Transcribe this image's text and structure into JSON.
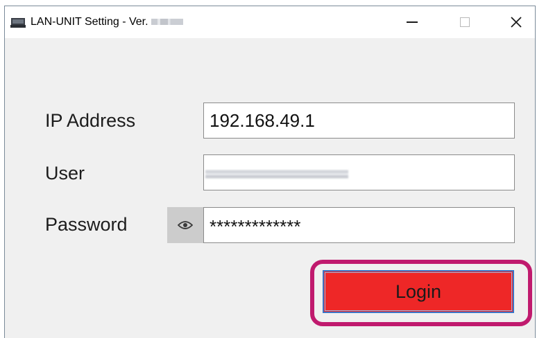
{
  "window": {
    "title": "LAN-UNIT Setting - Ver.",
    "controls": {
      "minimize_icon": "minimize-icon",
      "maximize_icon": "maximize-icon",
      "close_icon": "close-icon"
    }
  },
  "form": {
    "ip_label": "IP Address",
    "ip_value": "192.168.49.1",
    "user_label": "User",
    "password_label": "Password",
    "password_value": "*************",
    "show_password_icon": "eye-icon",
    "login_label": "Login"
  },
  "colors": {
    "login_button": "#ee2727",
    "login_border": "#3b74c7",
    "highlight_ring": "#c01a6e",
    "window_bg": "#f0f0f0"
  }
}
